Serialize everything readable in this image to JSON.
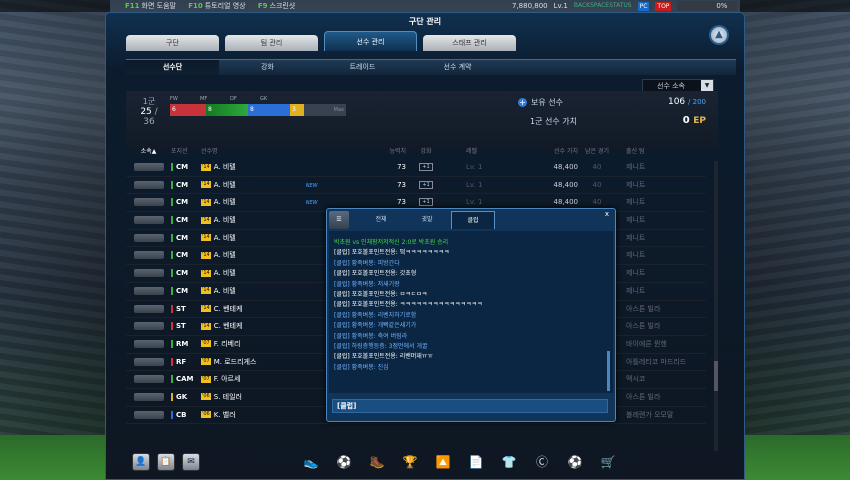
{
  "topbar": {
    "left": [
      {
        "key": "F11",
        "label": "화면 도움말"
      },
      {
        "key": "F10",
        "label": "튜토리얼 영상"
      },
      {
        "key": "F9",
        "label": "스크린샷"
      }
    ],
    "ep": "7,880,800",
    "level": "Lv.1",
    "server": "BACKSPACESTATUS",
    "pc": "PC",
    "top": "TOP",
    "percent": "0%"
  },
  "window": {
    "title": "구단 관리",
    "tabs": [
      "구단",
      "팀 관리",
      "선수 관리",
      "스태프 관리"
    ],
    "subtabs": [
      "선수단",
      "강화",
      "트레이드",
      "선수 계약"
    ],
    "sort_select": "선수 소속",
    "sort_arrow": "▼",
    "up_icon": "▲"
  },
  "summary": {
    "squad_label": "1군",
    "squad_count": "25",
    "squad_max": "/ 36",
    "positions": [
      {
        "label": "FW",
        "count": "6",
        "color": "#c8323a"
      },
      {
        "label": "MF",
        "count": "8",
        "color": "#2fa83a"
      },
      {
        "label": "DF",
        "count": "8",
        "color": "#2b6fd6"
      },
      {
        "label": "GK",
        "count": "3",
        "color": "#e0b020"
      }
    ],
    "pos_max": "Max",
    "owned_label": "보유 선수",
    "owned_value": "106",
    "owned_max": "/ 200",
    "value_label": "1군 선수 가치",
    "value": "0",
    "value_unit": "EP"
  },
  "table": {
    "headers": [
      "소속▲",
      "포지션",
      "선수명",
      "능력치",
      "강화",
      "레벨",
      "선수 가치",
      "남은 경기",
      "출신 팀"
    ],
    "rows": [
      {
        "pos": "CM",
        "season": "'14",
        "name": "A. 비텔",
        "new": "",
        "ovr": "73",
        "lv": "Lv. 1",
        "value": "48,400",
        "games": "40",
        "team": "제니트",
        "pc": "#35b03a"
      },
      {
        "pos": "CM",
        "season": "'14",
        "name": "A. 비텔",
        "new": "NEW",
        "ovr": "73",
        "lv": "Lv. 1",
        "value": "48,400",
        "games": "40",
        "team": "제니트",
        "pc": "#35b03a"
      },
      {
        "pos": "CM",
        "season": "'14",
        "name": "A. 비텔",
        "new": "NEW",
        "ovr": "73",
        "lv": "Lv. 1",
        "value": "48,400",
        "games": "40",
        "team": "제니트",
        "pc": "#35b03a"
      },
      {
        "pos": "CM",
        "season": "'14",
        "name": "A. 비텔",
        "new": "",
        "ovr": "",
        "lv": "",
        "value": "",
        "games": "",
        "team": "제니트",
        "pc": "#35b03a"
      },
      {
        "pos": "CM",
        "season": "'14",
        "name": "A. 비텔",
        "new": "",
        "ovr": "",
        "lv": "",
        "value": "",
        "games": "",
        "team": "제니트",
        "pc": "#35b03a"
      },
      {
        "pos": "CM",
        "season": "'14",
        "name": "A. 비텔",
        "new": "",
        "ovr": "",
        "lv": "",
        "value": "",
        "games": "",
        "team": "제니트",
        "pc": "#35b03a"
      },
      {
        "pos": "CM",
        "season": "'14",
        "name": "A. 비텔",
        "new": "",
        "ovr": "",
        "lv": "",
        "value": "",
        "games": "",
        "team": "제니트",
        "pc": "#35b03a"
      },
      {
        "pos": "CM",
        "season": "'14",
        "name": "A. 비텔",
        "new": "",
        "ovr": "",
        "lv": "",
        "value": "",
        "games": "",
        "team": "제니트",
        "pc": "#35b03a"
      },
      {
        "pos": "ST",
        "season": "'14",
        "name": "C. 벤테케",
        "new": "",
        "ovr": "",
        "lv": "",
        "value": "",
        "games": "",
        "team": "아스톤 빌라",
        "pc": "#d03030"
      },
      {
        "pos": "ST",
        "season": "'14",
        "name": "C. 벤테케",
        "new": "",
        "ovr": "",
        "lv": "",
        "value": "",
        "games": "",
        "team": "아스톤 빌라",
        "pc": "#d03030"
      },
      {
        "pos": "RM",
        "season": "'07",
        "name": "F. 리베리",
        "new": "",
        "ovr": "",
        "lv": "",
        "value": "",
        "games": "",
        "team": "바이에른 뮌헨",
        "pc": "#35b03a"
      },
      {
        "pos": "RF",
        "season": "'07",
        "name": "M. 로드리게스",
        "new": "",
        "ovr": "",
        "lv": "",
        "value": "",
        "games": "",
        "team": "아틀레티코 마드리드",
        "pc": "#d03030"
      },
      {
        "pos": "CAM",
        "season": "'07",
        "name": "F. 아르세",
        "new": "",
        "ovr": "",
        "lv": "",
        "value": "",
        "games": "",
        "team": "멕시코",
        "pc": "#35b03a"
      },
      {
        "pos": "GK",
        "season": "'06",
        "name": "S. 테일러",
        "new": "",
        "ovr": "",
        "lv": "",
        "value": "",
        "games": "",
        "team": "아스톤 빌라",
        "pc": "#e0b020"
      },
      {
        "pos": "CB",
        "season": "'06",
        "name": "K. 벨러",
        "new": "",
        "ovr": "",
        "lv": "",
        "value": "",
        "games": "",
        "team": "볼레렌가 오모말",
        "pc": "#2b6fd6"
      }
    ]
  },
  "chat": {
    "list_icon": "☰",
    "tabs": [
      "전체",
      "귓말",
      "클럽"
    ],
    "close": "x",
    "messages": [
      {
        "t": "박초원 vs 인체팡저저적신 2:0로 박초원 승리",
        "c": "g"
      },
      {
        "t": "[클럽] 포호볼포인트전용: 떸ㅋㅋㅋㅋㅋㅋㅋㅋ",
        "c": "w"
      },
      {
        "t": "[클럽] 황족벼봉: 피방간다",
        "c": "b"
      },
      {
        "t": "[클럽] 포호볼포인트전용: 갓초형",
        "c": "w"
      },
      {
        "t": "[클럽] 황족벼봉: 저새기랑",
        "c": "b"
      },
      {
        "t": "[클럽] 포호볼포인트전용: ㅁㅋㄷㅁㅋ",
        "c": "w"
      },
      {
        "t": "[클럽] 포호볼포인트전용: ㅋㅋㅋㅋㅋㅋㅋㅋㅋㅋㅋㅋㅋㅋㅋ",
        "c": "w"
      },
      {
        "t": "[클럽] 황족벼봉: 리벤지하기로함",
        "c": "b"
      },
      {
        "t": "[클럽] 황족벼봉: 개빡같은새기가",
        "c": "b"
      },
      {
        "t": "[클럽] 황족벼봉: 축여 버림라",
        "c": "b"
      },
      {
        "t": "[클럽] 하링층행등층: 3점먼에서 개꿀",
        "c": "b"
      },
      {
        "t": "[클럽] 포호볼포인트전용: 리밴머재ㅠㅠ",
        "c": "w"
      },
      {
        "t": "[클럽] 황족벼봉: 진심",
        "c": "b"
      }
    ],
    "input": "[클럽]"
  },
  "dock": {
    "left": [
      "👤",
      "📋",
      "✉"
    ],
    "main": [
      "👟",
      "⚽",
      "🥾",
      "🏆",
      "🔼",
      "📄",
      "👕",
      "Ⓒ",
      "⚽",
      "🛒"
    ]
  }
}
